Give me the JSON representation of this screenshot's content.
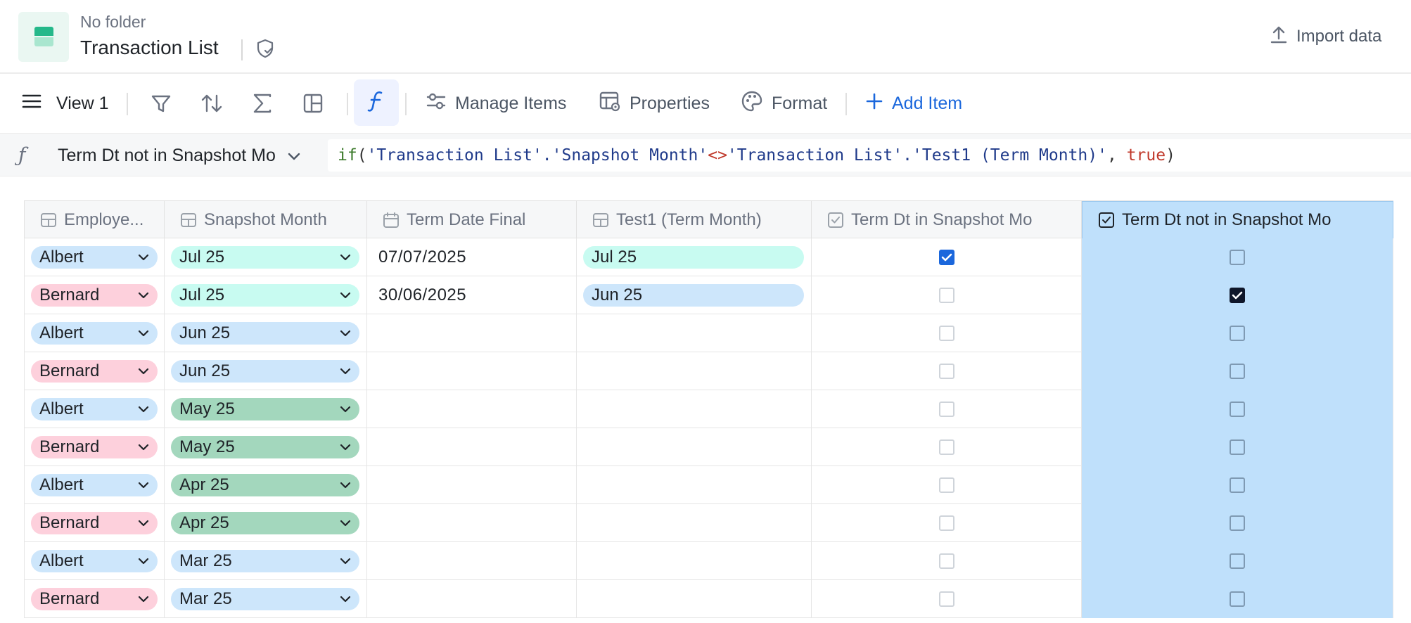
{
  "header": {
    "folder": "No folder",
    "title": "Transaction List",
    "import_label": "Import data"
  },
  "toolbar": {
    "view_label": "View 1",
    "manage_items": "Manage Items",
    "properties": "Properties",
    "format": "Format",
    "add_item": "Add Item",
    "accent": "#1b67dc"
  },
  "formula": {
    "symbol": "ƒ",
    "field": "Term Dt not in Snapshot Mo",
    "tokens": {
      "fn": "if",
      "open": "(",
      "arg1": "'Transaction List'.'Snapshot Month'",
      "op": "<>",
      "arg2": "'Transaction List'.'Test1 (Term Month)'",
      "comma": ", ",
      "kw": "true",
      "close": ")"
    }
  },
  "columns": [
    {
      "label": "Employe...",
      "icon": "linked-record-icon"
    },
    {
      "label": "Snapshot Month",
      "icon": "linked-record-icon"
    },
    {
      "label": "Term Date Final",
      "icon": "calendar-icon"
    },
    {
      "label": "Test1 (Term Month)",
      "icon": "linked-record-icon"
    },
    {
      "label": "Term Dt in Snapshot Mo",
      "icon": "checkbox-icon"
    },
    {
      "label": "Term Dt not in Snapshot Mo",
      "icon": "checkbox-icon"
    }
  ],
  "rows": [
    {
      "employee": "Albert",
      "snapshot": "Jul 25",
      "term_date": "07/07/2025",
      "test1": "Jul 25",
      "in_mo": true,
      "not_in_mo": false
    },
    {
      "employee": "Bernard",
      "snapshot": "Jul 25",
      "term_date": "30/06/2025",
      "test1": "Jun 25",
      "in_mo": false,
      "not_in_mo": true
    },
    {
      "employee": "Albert",
      "snapshot": "Jun 25",
      "term_date": "",
      "test1": "",
      "in_mo": false,
      "not_in_mo": false
    },
    {
      "employee": "Bernard",
      "snapshot": "Jun 25",
      "term_date": "",
      "test1": "",
      "in_mo": false,
      "not_in_mo": false
    },
    {
      "employee": "Albert",
      "snapshot": "May 25",
      "term_date": "",
      "test1": "",
      "in_mo": false,
      "not_in_mo": false
    },
    {
      "employee": "Bernard",
      "snapshot": "May 25",
      "term_date": "",
      "test1": "",
      "in_mo": false,
      "not_in_mo": false
    },
    {
      "employee": "Albert",
      "snapshot": "Apr 25",
      "term_date": "",
      "test1": "",
      "in_mo": false,
      "not_in_mo": false
    },
    {
      "employee": "Bernard",
      "snapshot": "Apr 25",
      "term_date": "",
      "test1": "",
      "in_mo": false,
      "not_in_mo": false
    },
    {
      "employee": "Albert",
      "snapshot": "Mar 25",
      "term_date": "",
      "test1": "",
      "in_mo": false,
      "not_in_mo": false
    },
    {
      "employee": "Bernard",
      "snapshot": "Mar 25",
      "term_date": "",
      "test1": "",
      "in_mo": false,
      "not_in_mo": false
    }
  ],
  "colors": {
    "employee": {
      "Albert": "#cde6fb",
      "Bernard": "#fdd0dc"
    },
    "month": {
      "Jul 25": "#c8fbf1",
      "Jun 25": "#cde6fb",
      "May 25": "#a3d7bd",
      "Apr 25": "#a3d7bd",
      "Mar 25": "#cde6fb"
    },
    "selected_column": "#bfe0fb"
  }
}
